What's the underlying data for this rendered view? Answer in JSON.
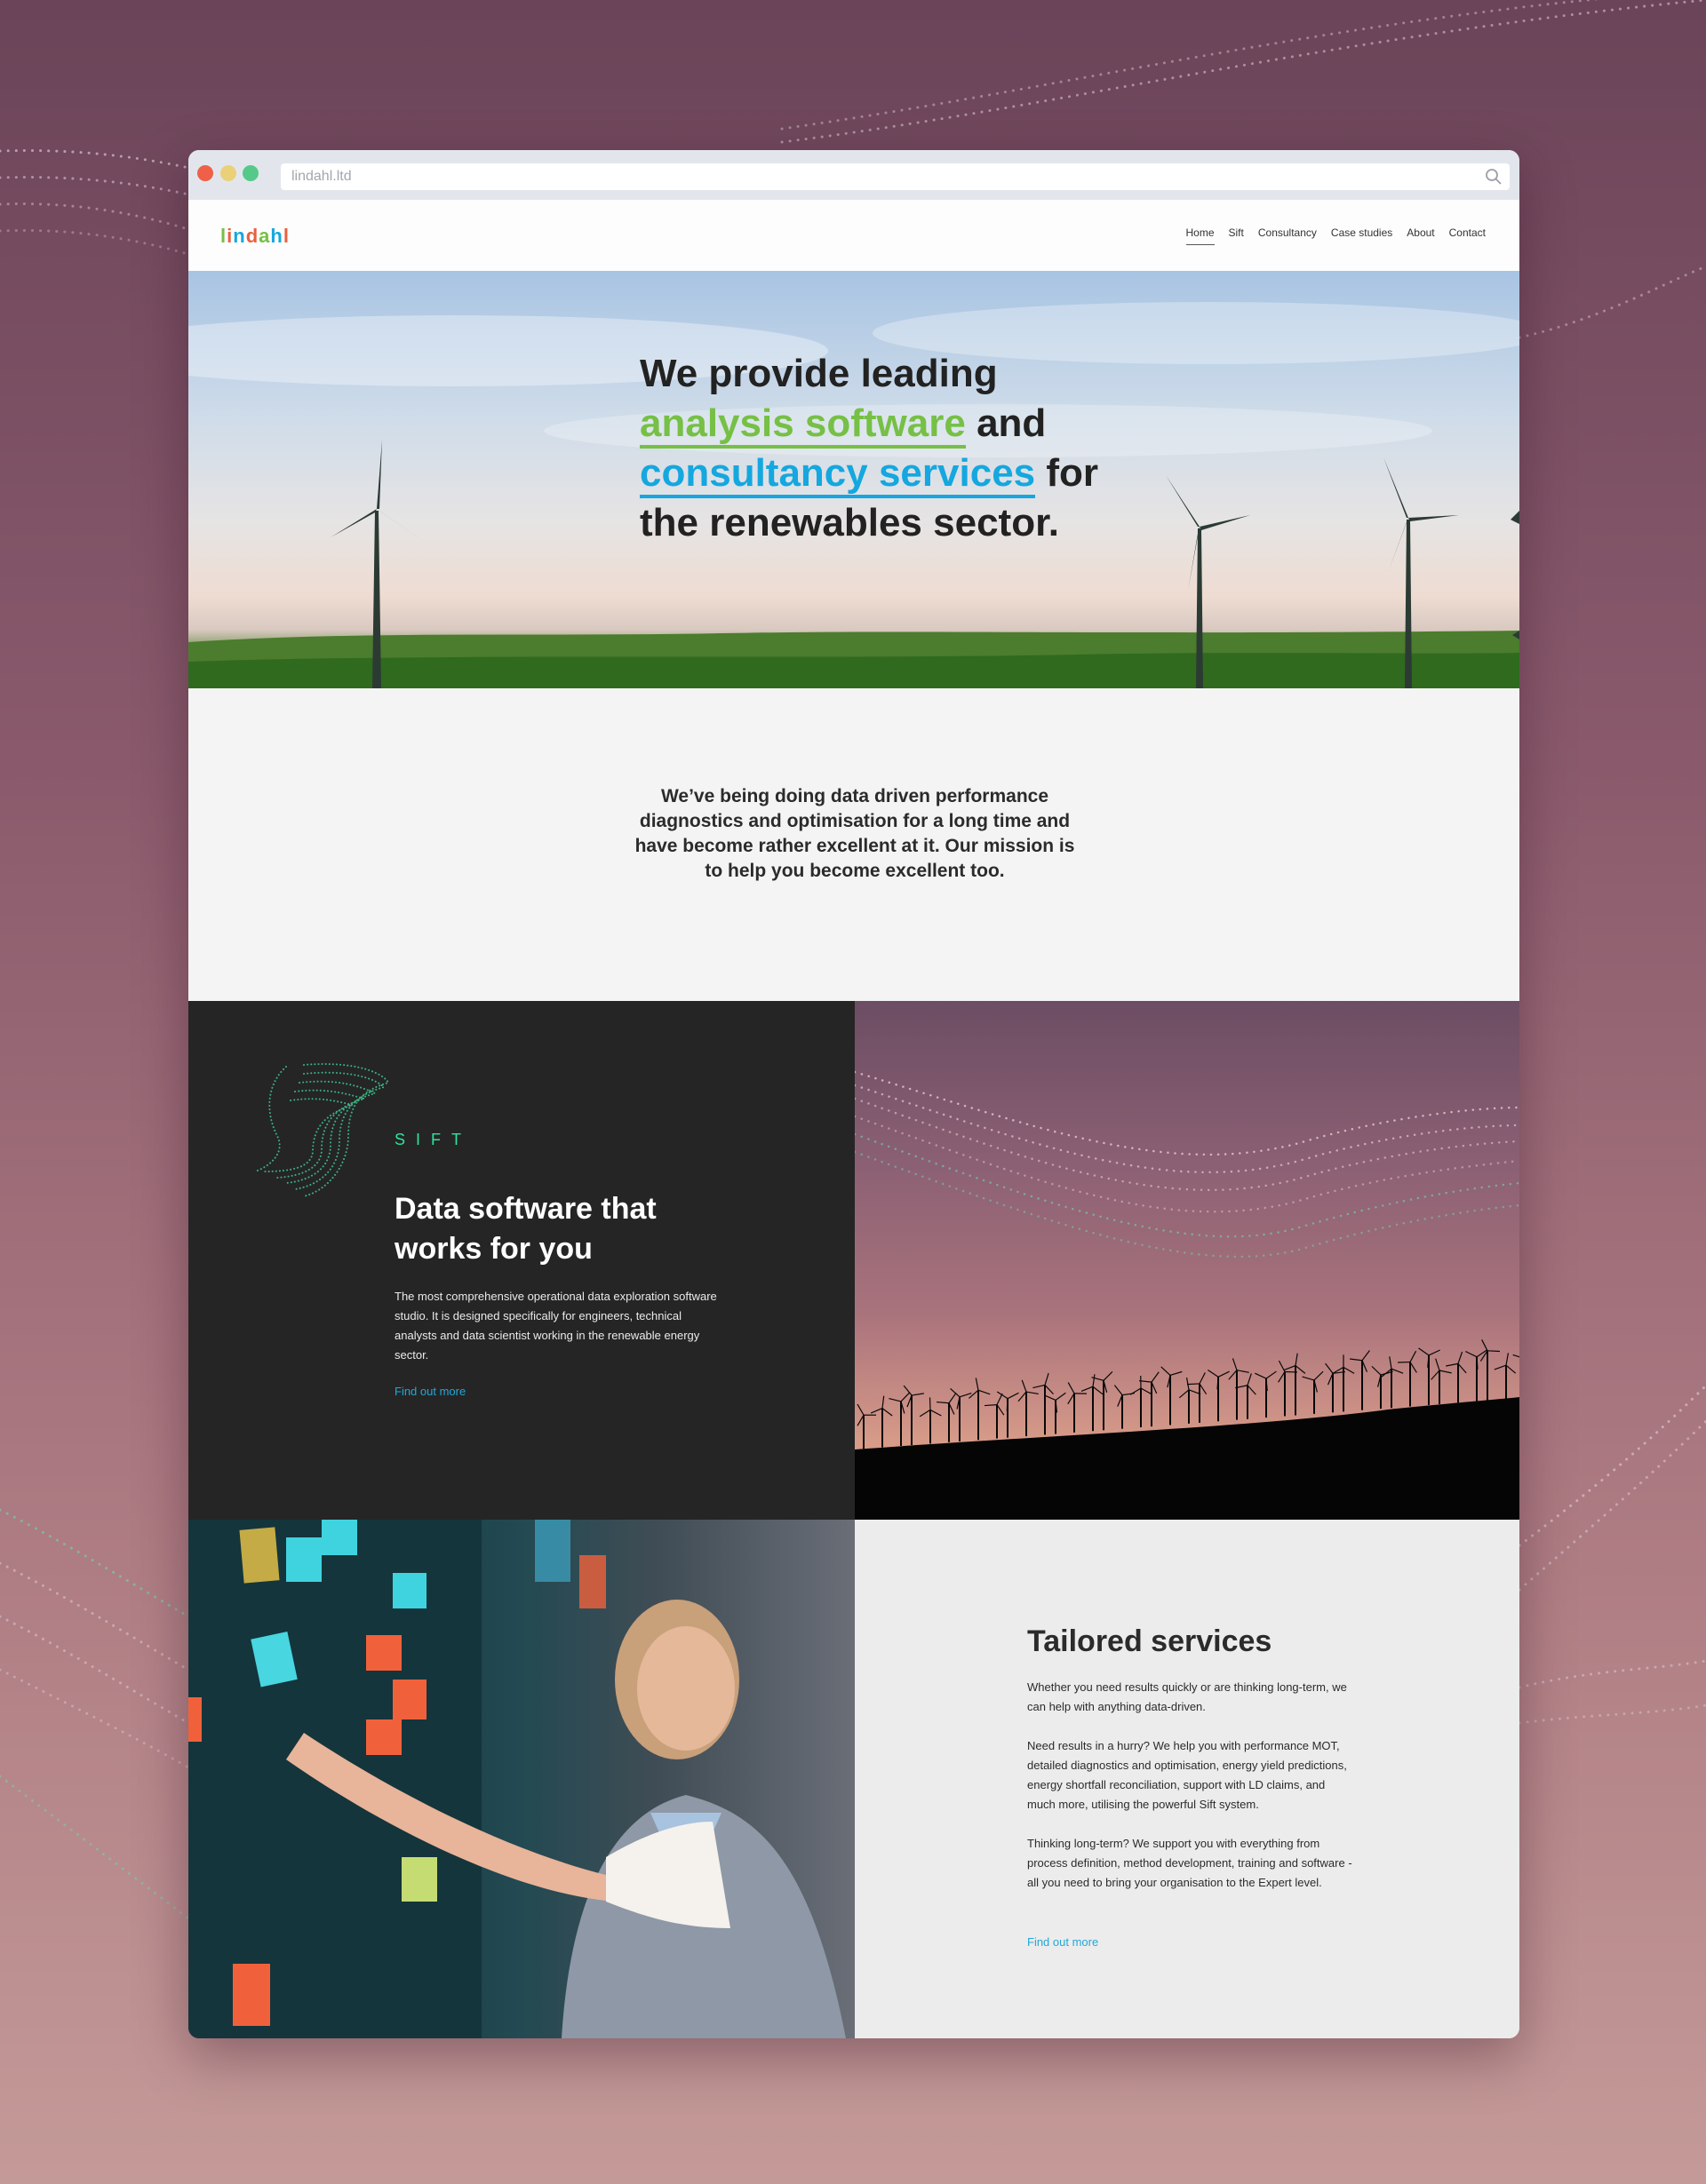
{
  "browser": {
    "url": "lindahl.ltd",
    "search_value": ""
  },
  "site": {
    "logo_text": "lindahl",
    "logo_letters": [
      "l",
      "i",
      "n",
      "d",
      "a",
      "h",
      "l"
    ],
    "logo_colors": [
      "#76c045",
      "#e8613f",
      "#15a7df",
      "#e8613f",
      "#76c045",
      "#15a7df",
      "#e8613f"
    ],
    "nav": [
      {
        "label": "Home",
        "active": true
      },
      {
        "label": "Sift",
        "active": false
      },
      {
        "label": "Consultancy",
        "active": false
      },
      {
        "label": "Case studies",
        "active": false
      },
      {
        "label": "About",
        "active": false
      },
      {
        "label": "Contact",
        "active": false
      }
    ]
  },
  "hero": {
    "line1": "We provide leading",
    "highlight_software": "analysis software",
    "connector_and": " and",
    "highlight_consultancy": "consultancy services",
    "connector_for": " for",
    "line4": "the renewables sector.",
    "accent_green": "#76c045",
    "accent_blue": "#15a7df"
  },
  "mission": {
    "text": "We’ve being doing data driven performance diagnostics and optimisation for a long time and have become rather excellent at it. Our mission is to help you become excellent too."
  },
  "sift": {
    "label": "SIFT",
    "title": "Data software that works for you",
    "body": "The most comprehensive operational data exploration software studio. It is designed specifically for engineers, technical analysts and data scientist working in the renewable energy sector.",
    "link": "Find out more",
    "accent": "#2ee59a"
  },
  "services": {
    "title": "Tailored services",
    "p1": "Whether you need results quickly or  are thinking long-term, we can help with anything data-driven.",
    "p2": "Need results in a hurry? We help you with performance MOT, detailed diagnostics and optimisation, energy yield predictions, energy shortfall reconciliation,  support with LD claims, and much more, utilising the powerful Sift system.",
    "p3": "Thinking long-term? We support you with everything from process definition, method development, training and software - all you need to bring your organisation to the Expert level.",
    "link": "Find out more",
    "link_color": "#23a8d8"
  }
}
